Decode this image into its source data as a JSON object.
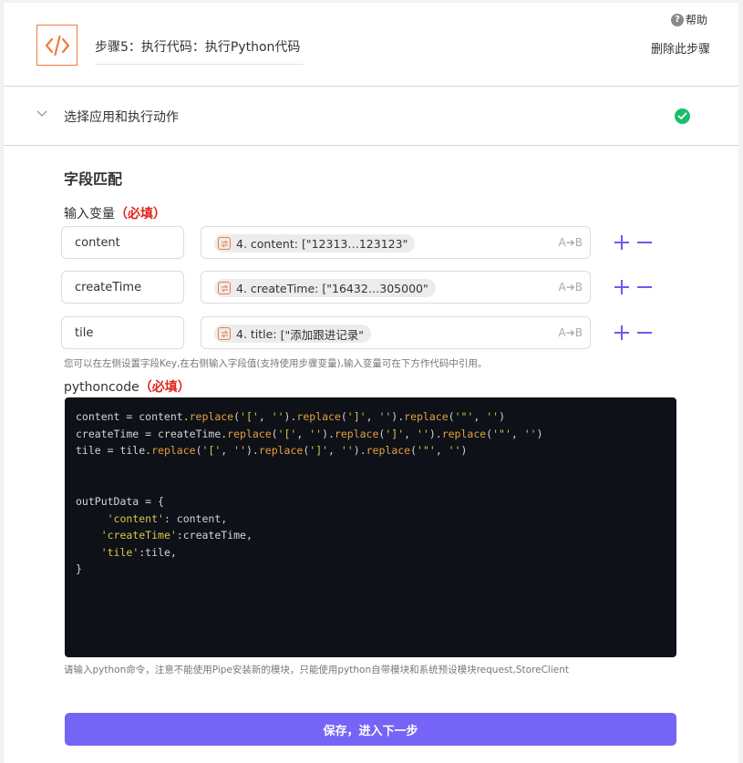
{
  "header": {
    "step_title": "步骤5：执行代码：执行Python代码",
    "help_label": "帮助",
    "delete_label": "删除此步骤"
  },
  "section": {
    "label": "选择应用和执行动作"
  },
  "fields": {
    "title": "字段匹配",
    "input_label": "输入变量",
    "required_tag": "（必填）",
    "rows": [
      {
        "key": "content",
        "chip_key": "4. content:",
        "chip_value": "[\"12313…123123\""
      },
      {
        "key": "createTime",
        "chip_key": "4. createTime:",
        "chip_value": "[\"16432…305000\""
      },
      {
        "key": "tile",
        "chip_key": "4. title:",
        "chip_value": "[\"添加跟进记录\""
      }
    ],
    "ab_label": "A➔B",
    "hint": "您可以在左侧设置字段Key,在右侧输入字段值(支持使用步骤变量),输入变量可在下方作代码中引用。"
  },
  "code": {
    "label": "pythoncode",
    "required_tag": "（必填）",
    "lines": [
      [
        [
          "plain",
          "content = content."
        ],
        [
          "fn",
          "replace"
        ],
        [
          "plain",
          "("
        ],
        [
          "str",
          "'['"
        ],
        [
          "plain",
          ", "
        ],
        [
          "str",
          "''"
        ],
        [
          "plain",
          ")."
        ],
        [
          "fn",
          "replace"
        ],
        [
          "plain",
          "("
        ],
        [
          "str",
          "']'"
        ],
        [
          "plain",
          ", "
        ],
        [
          "str",
          "''"
        ],
        [
          "plain",
          ")."
        ],
        [
          "fn",
          "replace"
        ],
        [
          "plain",
          "("
        ],
        [
          "str",
          "'\"'"
        ],
        [
          "plain",
          ", "
        ],
        [
          "str",
          "''"
        ],
        [
          "plain",
          ")"
        ]
      ],
      [
        [
          "plain",
          "createTime = createTime."
        ],
        [
          "fn",
          "replace"
        ],
        [
          "plain",
          "("
        ],
        [
          "str",
          "'['"
        ],
        [
          "plain",
          ", "
        ],
        [
          "str",
          "''"
        ],
        [
          "plain",
          ")."
        ],
        [
          "fn",
          "replace"
        ],
        [
          "plain",
          "("
        ],
        [
          "str",
          "']'"
        ],
        [
          "plain",
          ", "
        ],
        [
          "str",
          "''"
        ],
        [
          "plain",
          ")."
        ],
        [
          "fn",
          "replace"
        ],
        [
          "plain",
          "("
        ],
        [
          "str",
          "'\"'"
        ],
        [
          "plain",
          ", "
        ],
        [
          "str",
          "''"
        ],
        [
          "plain",
          ")"
        ]
      ],
      [
        [
          "plain",
          "tile = tile."
        ],
        [
          "fn",
          "replace"
        ],
        [
          "plain",
          "("
        ],
        [
          "str",
          "'['"
        ],
        [
          "plain",
          ", "
        ],
        [
          "str",
          "''"
        ],
        [
          "plain",
          ")."
        ],
        [
          "fn",
          "replace"
        ],
        [
          "plain",
          "("
        ],
        [
          "str",
          "']'"
        ],
        [
          "plain",
          ", "
        ],
        [
          "str",
          "''"
        ],
        [
          "plain",
          ")."
        ],
        [
          "fn",
          "replace"
        ],
        [
          "plain",
          "("
        ],
        [
          "str",
          "'\"'"
        ],
        [
          "plain",
          ", "
        ],
        [
          "str",
          "''"
        ],
        [
          "plain",
          ")"
        ]
      ],
      [],
      [],
      [
        [
          "plain",
          "outPutData = {"
        ]
      ],
      [
        [
          "plain",
          "     "
        ],
        [
          "str",
          "'content'"
        ],
        [
          "plain",
          ": content,"
        ]
      ],
      [
        [
          "plain",
          "    "
        ],
        [
          "str",
          "'createTime'"
        ],
        [
          "plain",
          ":createTime,"
        ]
      ],
      [
        [
          "plain",
          "    "
        ],
        [
          "str",
          "'tile'"
        ],
        [
          "plain",
          ":tile,"
        ]
      ],
      [
        [
          "plain",
          "}"
        ]
      ]
    ],
    "hint": "请输入python命令，注意不能使用Pipe安装新的模块，只能使用python自带模块和系统预设模块request,StoreClient"
  },
  "save_button": "保存，进入下一步",
  "colors": {
    "accent": "#7564f6",
    "icon_orange": "#f07b3f",
    "success": "#19be6b",
    "required": "#e0241b",
    "code_bg": "#0e1117"
  }
}
